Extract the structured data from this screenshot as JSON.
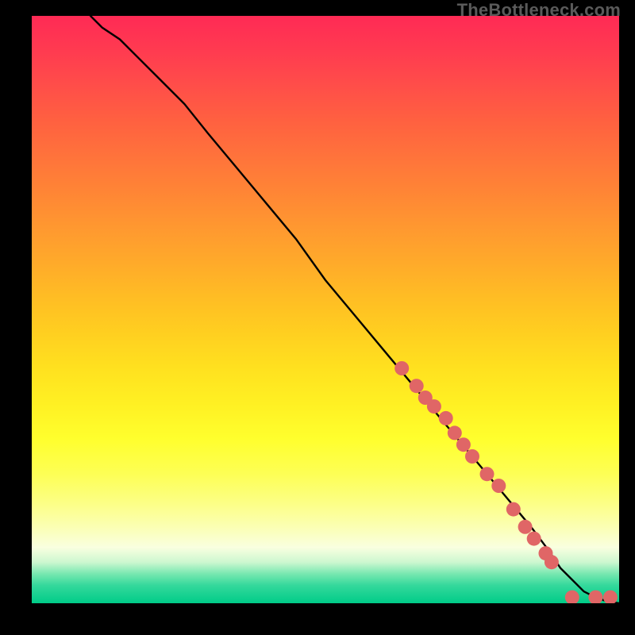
{
  "watermark": "TheBottleneck.com",
  "colors": {
    "page_bg": "#000000",
    "curve": "#000000",
    "marker_fill": "#e06666",
    "marker_stroke": "#c95555",
    "gradient_top": "#ff2a55",
    "gradient_mid": "#ffe11f",
    "gradient_bottom": "#00cc88"
  },
  "chart_data": {
    "type": "line",
    "title": "",
    "xlabel": "",
    "ylabel": "",
    "xlim": [
      0,
      100
    ],
    "ylim": [
      0,
      100
    ],
    "grid": false,
    "series": [
      {
        "name": "curve",
        "style": "line",
        "x": [
          10,
          12,
          15,
          18,
          22,
          26,
          30,
          35,
          40,
          45,
          50,
          55,
          60,
          65,
          70,
          75,
          80,
          85,
          88,
          90,
          92,
          94,
          96,
          98,
          100
        ],
        "values": [
          100,
          98,
          96,
          93,
          89,
          85,
          80,
          74,
          68,
          62,
          55,
          49,
          43,
          37,
          31,
          25,
          19,
          13,
          9,
          6,
          4,
          2,
          1,
          0.3,
          0
        ]
      },
      {
        "name": "markers",
        "style": "scatter",
        "x": [
          63,
          65.5,
          67,
          68.5,
          70.5,
          72,
          73.5,
          75,
          77.5,
          79.5,
          82,
          84,
          85.5,
          87.5,
          88.5,
          92,
          96,
          98.5
        ],
        "values": [
          40,
          37,
          35,
          33.5,
          31.5,
          29,
          27,
          25,
          22,
          20,
          16,
          13,
          11,
          8.5,
          7,
          1,
          1,
          1
        ]
      }
    ]
  }
}
